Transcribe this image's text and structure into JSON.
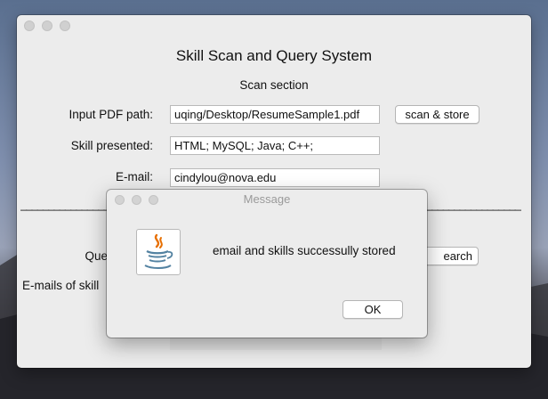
{
  "app": {
    "title": "Skill Scan and Query System",
    "scan_section": "Scan section"
  },
  "scan": {
    "pdf_label": "Input PDF path:",
    "pdf_value": "uqing/Desktop/ResumeSample1.pdf",
    "scan_button": "scan & store",
    "skills_label": "Skill presented:",
    "skills_value": "HTML;  MySQL;  Java;  C++;",
    "email_label": "E-mail:",
    "email_value": "cindylou@nova.edu"
  },
  "divider": {
    "left": "__________________",
    "right": "_________________"
  },
  "query": {
    "label_partial": "Que",
    "search_button_partial": "earch",
    "emails_label_partial": "E-mails of skill"
  },
  "dialog": {
    "title": "Message",
    "message": "email and skills successully stored",
    "ok_button": "OK",
    "icon": "java-icon"
  }
}
